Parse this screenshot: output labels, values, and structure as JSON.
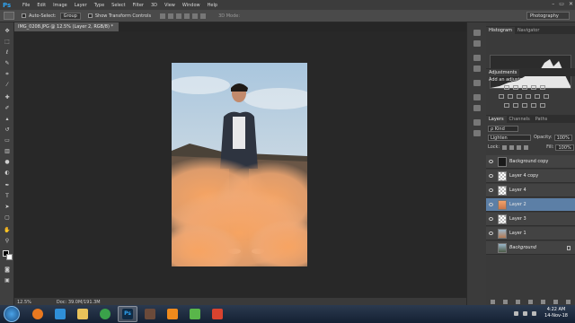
{
  "app": {
    "name": "Ps"
  },
  "menu": [
    "File",
    "Edit",
    "Image",
    "Layer",
    "Type",
    "Select",
    "Filter",
    "3D",
    "View",
    "Window",
    "Help"
  ],
  "window_controls": [
    "–",
    "▭",
    "✕"
  ],
  "options_bar": {
    "auto_select_label": "Auto-Select:",
    "auto_select_value": "Group",
    "show_transform_label": "Show Transform Controls",
    "mode_3d_label": "3D Mode:",
    "workspace": "Photography"
  },
  "document": {
    "tab_title": "IMG_0208.JPG @ 12.5% (Layer 2, RGB/8) *",
    "zoom": "12.5%",
    "doc_size": "Doc: 39.0M/191.3M"
  },
  "panels": {
    "histogram_tabs": [
      "Histogram",
      "Navigator"
    ],
    "adjustments_tab": "Adjustments",
    "adjustments_title": "Add an adjustment",
    "layers_tabs": [
      "Layers",
      "Channels",
      "Paths"
    ],
    "kind_filter": "ρ Kind",
    "blend_mode": "Lighten",
    "opacity_label": "Opacity:",
    "opacity_value": "100%",
    "lock_label": "Lock:",
    "fill_label": "Fill:",
    "fill_value": "100%"
  },
  "layers": [
    {
      "name": "Background copy",
      "selected": false,
      "italic": false
    },
    {
      "name": "Layer 4 copy",
      "selected": false,
      "italic": false
    },
    {
      "name": "Layer 4",
      "selected": false,
      "italic": false
    },
    {
      "name": "Layer 2",
      "selected": true,
      "italic": false
    },
    {
      "name": "Layer 3",
      "selected": false,
      "italic": false
    },
    {
      "name": "Layer 1",
      "selected": false,
      "italic": false
    },
    {
      "name": "Background",
      "selected": false,
      "italic": true
    }
  ],
  "taskbar": {
    "apps": [
      {
        "name": "firefox-icon",
        "color": "#e8781f"
      },
      {
        "name": "ie-icon",
        "color": "#2f8fd8"
      },
      {
        "name": "explorer-icon",
        "color": "#e8c25a"
      },
      {
        "name": "chrome-icon",
        "color": "#3aa24a"
      },
      {
        "name": "photoshop-icon",
        "color": "#0f2b45",
        "glyph": "Ps",
        "active": true
      },
      {
        "name": "photos-icon",
        "color": "#6b4a3a"
      },
      {
        "name": "vlc-icon",
        "color": "#f08a1c"
      },
      {
        "name": "camtasia-icon",
        "color": "#59b64a"
      },
      {
        "name": "recorder-icon",
        "color": "#d9432f"
      }
    ],
    "time": "4:22 AM",
    "date": "14-Nov-18"
  },
  "colors": {
    "accent_selected_layer": "#5c7fa6",
    "ps_blue": "#2fa3f0"
  }
}
